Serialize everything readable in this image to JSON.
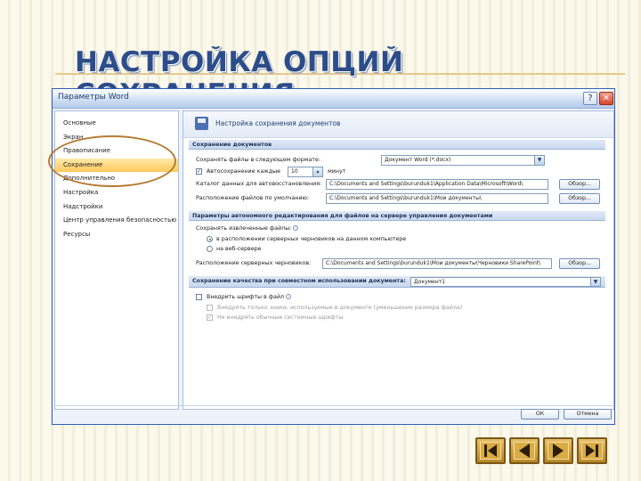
{
  "slide": {
    "title": "НАСТРОЙКА ОПЦИЙ\nСОХРАНЕНИЯ"
  },
  "dialog": {
    "title": "Параметры Word",
    "help_label": "?",
    "close_label": "✕",
    "nav": [
      {
        "label": "Основные"
      },
      {
        "label": "Экран"
      },
      {
        "label": "Правописание"
      },
      {
        "label": "Сохранение",
        "selected": true
      },
      {
        "label": "Дополнительно"
      },
      {
        "label": "Настройка"
      },
      {
        "label": "Надстройки"
      },
      {
        "label": "Центр управления безопасностью"
      },
      {
        "label": "Ресурсы"
      }
    ],
    "header": "Настройка сохранения документов",
    "sections": {
      "save_docs": "Сохранение документов",
      "offline": "Параметры автономного редактирования для файлов на сервере управления документами",
      "quality": "Сохранение качества при совместном использовании документа:"
    },
    "save_docs": {
      "format_label": "Сохранять файлы в следующем формате:",
      "format_value": "Документ Word (*.docx)",
      "autosave_check": "✓",
      "autosave_label": "Автосохранение каждые",
      "autosave_value": "10",
      "autosave_unit": "минут",
      "autorecover_label": "Каталог данных для автовосстановления:",
      "autorecover_path": "C:\\Documents and Settings\\burunduk1\\Application Data\\Microsoft\\Word\\",
      "default_label": "Расположение файлов по умолчанию:",
      "default_path": "C:\\Documents and Settings\\burunduk1\\Мои документы\\",
      "browse_label": "Обзор..."
    },
    "offline": {
      "save_to_label": "Сохранять извлеченные файлы:",
      "option1": "в расположении серверных черновиков на данном компьютере",
      "option2": "на веб-сервере",
      "drafts_label": "Расположение серверных черновиков:",
      "drafts_path": "C:\\Documents and Settings\\burunduk1\\Мои документы\\Черновики SharePoint\\",
      "browse_label": "Обзор..."
    },
    "quality": {
      "doc_value": "Документ1",
      "embed_fonts_label": "Внедрить шрифты в файл",
      "embed_used_label": "Внедрять только знаки, используемые в документе (уменьшение размера файла)",
      "no_system_label": "Не внедрять обычные системные шрифты",
      "no_system_check": "✓"
    },
    "ok_label": "ОК",
    "cancel_label": "Отмена"
  },
  "colors": {
    "title": "#2c4d8a",
    "highlight": "#b57b33",
    "nav_button": "#d8ab45"
  }
}
